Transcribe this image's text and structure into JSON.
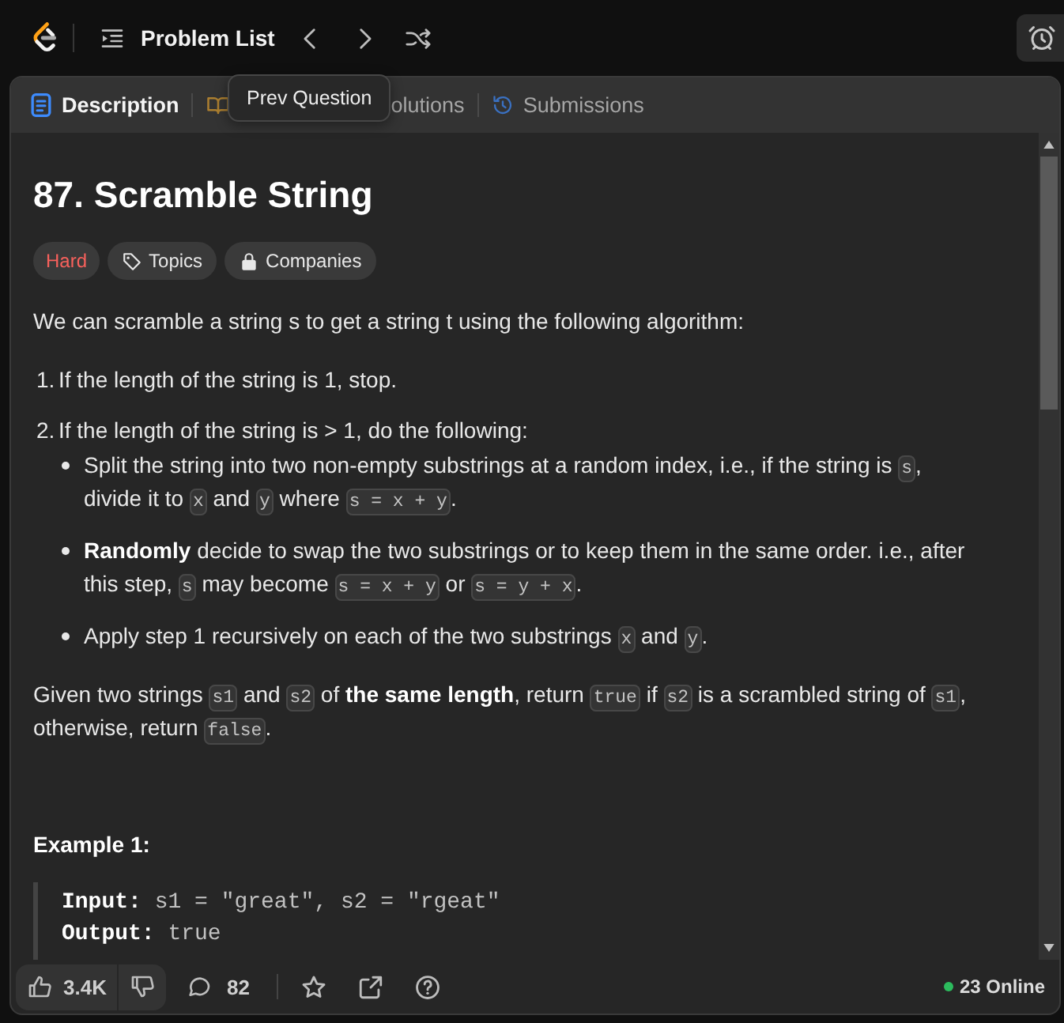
{
  "top_bar": {
    "title": "Problem List"
  },
  "tooltip": {
    "text": "Prev Question"
  },
  "tabs": [
    {
      "kind": "description",
      "label": "Description",
      "selected": true
    },
    {
      "kind": "editorial",
      "selected": false
    },
    {
      "kind": "solutions",
      "label": "olutions",
      "selected": false
    },
    {
      "kind": "submissions",
      "label": "Submissions",
      "selected": false
    }
  ],
  "problem": {
    "title": "87. Scramble String",
    "tags": [
      {
        "kind": "difficulty",
        "label": "Hard"
      },
      {
        "kind": "topics",
        "label": "Topics"
      },
      {
        "kind": "companies",
        "label": "Companies"
      }
    ],
    "description": [
      {
        "kind": "paragraph",
        "parts": [
          {
            "kind": "text",
            "text": "We can scramble a string s to get a string t using the following algorithm:"
          }
        ]
      },
      {
        "kind": "steps",
        "items": [
          {
            "number": "1.",
            "parts": [
              {
                "kind": "text",
                "text": "If the length of the string is 1, stop."
              }
            ]
          },
          {
            "number": "2.",
            "parts": [
              {
                "kind": "text",
                "text": "If the length of the string is > 1, do the following:"
              }
            ],
            "bullets": [
              {
                "parts": [
                  {
                    "kind": "text",
                    "text": "Split the string into two non-empty substrings at a random index, i.e., if the string is "
                  },
                  {
                    "kind": "code",
                    "text": "s"
                  },
                  {
                    "kind": "text",
                    "text": ", divide it to "
                  },
                  {
                    "kind": "code",
                    "text": "x"
                  },
                  {
                    "kind": "text",
                    "text": " and "
                  },
                  {
                    "kind": "code",
                    "text": "y"
                  },
                  {
                    "kind": "text",
                    "text": " where "
                  },
                  {
                    "kind": "code",
                    "text": "s = x + y"
                  },
                  {
                    "kind": "text",
                    "text": "."
                  }
                ]
              },
              {
                "parts": [
                  {
                    "kind": "text",
                    "text": "**Randomly** decide to swap the two substrings or to keep them in the same order. i.e., after this step, "
                  },
                  {
                    "kind": "code",
                    "text": "s"
                  },
                  {
                    "kind": "text",
                    "text": " may become "
                  },
                  {
                    "kind": "code",
                    "text": "s = x + y"
                  },
                  {
                    "kind": "text",
                    "text": " or "
                  },
                  {
                    "kind": "code",
                    "text": "s = y + x"
                  },
                  {
                    "kind": "text",
                    "text": "."
                  }
                ]
              },
              {
                "parts": [
                  {
                    "kind": "text",
                    "text": "Apply step 1 recursively on each of the two substrings "
                  },
                  {
                    "kind": "code",
                    "text": "x"
                  },
                  {
                    "kind": "text",
                    "text": " and "
                  },
                  {
                    "kind": "code",
                    "text": "y"
                  },
                  {
                    "kind": "text",
                    "text": "."
                  }
                ]
              }
            ]
          }
        ]
      },
      {
        "kind": "paragraph",
        "parts": [
          {
            "kind": "text",
            "text": "Given two strings "
          },
          {
            "kind": "code",
            "text": "s1"
          },
          {
            "kind": "text",
            "text": " and "
          },
          {
            "kind": "code",
            "text": "s2"
          },
          {
            "kind": "text",
            "text": " of **the same length**, return "
          },
          {
            "kind": "code",
            "text": "true"
          },
          {
            "kind": "text",
            "text": " if "
          },
          {
            "kind": "code",
            "text": "s2"
          },
          {
            "kind": "text",
            "text": " is a scrambled string of "
          },
          {
            "kind": "code",
            "text": "s1"
          },
          {
            "kind": "text",
            "text": ", otherwise, return "
          },
          {
            "kind": "code",
            "text": "false"
          },
          {
            "kind": "text",
            "text": "."
          }
        ]
      },
      {
        "kind": "heading",
        "text": "Example 1:"
      },
      {
        "kind": "example",
        "lines": [
          "**Input:** s1 = \"great\", s2 = \"rgeat\"",
          "**Output:** true"
        ]
      }
    ]
  },
  "footer": {
    "likes": "3.4K",
    "comments": "82",
    "online": "23 Online"
  }
}
